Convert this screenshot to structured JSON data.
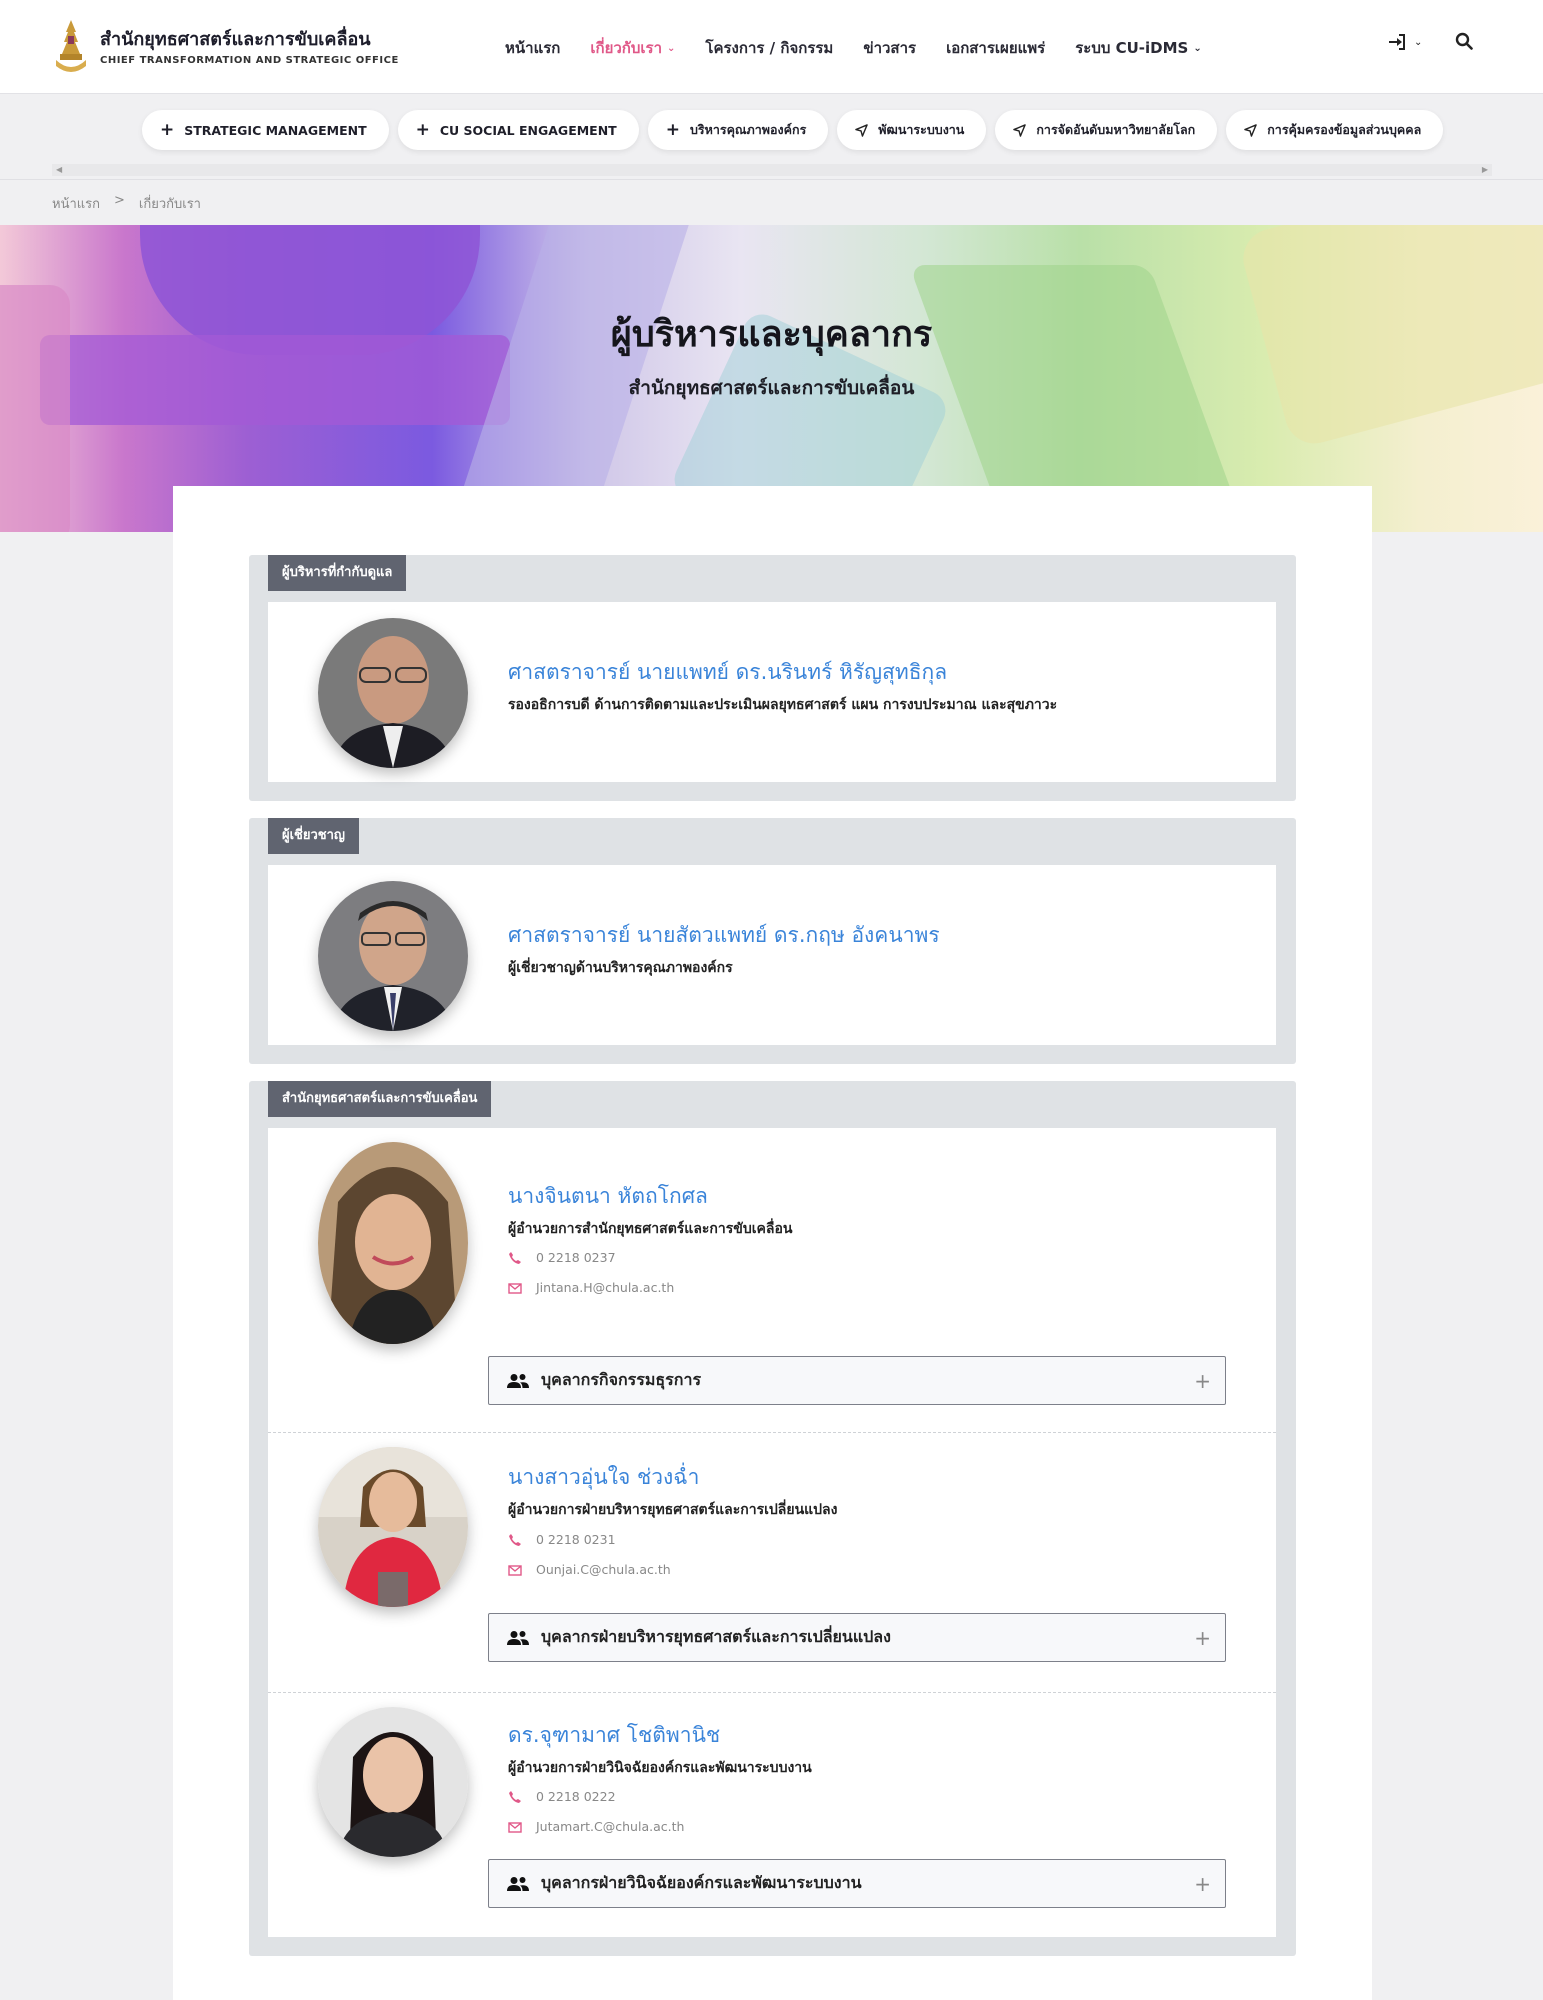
{
  "header": {
    "logo_th": "สำนักยุทธศาสตร์และการขับเคลื่อน",
    "logo_en": "CHIEF TRANSFORMATION AND STRATEGIC OFFICE",
    "nav": [
      "หน้าแรก",
      "เกี่ยวกับเรา",
      "โครงการ / กิจกรรม",
      "ข่าวสาร",
      "เอกสารเผยแพร่",
      "ระบบ CU-iDMS"
    ],
    "active_nav": "เกี่ยวกับเรา",
    "accent": "#e05888"
  },
  "quick_links": [
    {
      "label": "STRATEGIC MANAGEMENT",
      "icon": "plus-icon"
    },
    {
      "label": "CU SOCIAL ENGAGEMENT",
      "icon": "plus-icon"
    },
    {
      "label": "บริหารคุณภาพองค์กร",
      "icon": "plus-icon"
    },
    {
      "label": "พัฒนาระบบงาน",
      "icon": "send-icon"
    },
    {
      "label": "การจัดอันดับมหาวิทยาลัยโลก",
      "icon": "send-icon"
    },
    {
      "label": "การคุ้มครองข้อมูลส่วนบุคคล",
      "icon": "send-icon"
    }
  ],
  "breadcrumb": {
    "home": "หน้าแรก",
    "sep": ">",
    "current": "เกี่ยวกับเรา"
  },
  "banner": {
    "title": "ผู้บริหารและบุคลากร",
    "subtitle": "สำนักยุทธศาสตร์และการขับเคลื่อน"
  },
  "sections": [
    {
      "tag": "ผู้บริหารที่กำกับดูแล",
      "people": [
        {
          "name": "ศาสตราจารย์ นายแพทย์ ดร.นรินทร์ หิรัญสุทธิกุล",
          "role": "รองอธิการบดี ด้านการติดตามและประเมินผลยุทธศาสตร์ แผน การงบประมาณ และสุขภาวะ"
        }
      ]
    },
    {
      "tag": "ผู้เชี่ยวชาญ",
      "people": [
        {
          "name": "ศาสตราจารย์ นายสัตวแพทย์ ดร.กฤษ อังคนาพร",
          "role": "ผู้เชี่ยวชาญด้านบริหารคุณภาพองค์กร"
        }
      ]
    },
    {
      "tag": "สำนักยุทธศาสตร์และการขับเคลื่อน",
      "people": [
        {
          "name": "นางจินตนา หัตถโกศล",
          "role": "ผู้อำนวยการสำนักยุทธศาสตร์และการขับเคลื่อน",
          "phone": "0 2218 0237",
          "email": "Jintana.H@chula.ac.th",
          "group": "บุคลากรกิจกรรมธุรการ"
        },
        {
          "name": "นางสาวอุ่นใจ ช่วงฉ่ำ",
          "role": "ผู้อำนวยการฝ่ายบริหารยุทธศาสตร์และการเปลี่ยนแปลง",
          "phone": "0 2218 0231",
          "email": "Ounjai.C@chula.ac.th",
          "group": "บุคลากรฝ่ายบริหารยุทธศาสตร์และการเปลี่ยนแปลง"
        },
        {
          "name": "ดร.จุฑามาศ โชติพานิช",
          "role": "ผู้อำนวยการฝ่ายวินิจฉัยองค์กรและพัฒนาระบบงาน",
          "phone": "0 2218 0222",
          "email": "Jutamart.C@chula.ac.th",
          "group": "บุคลากรฝ่ายวินิจฉัยองค์กรและพัฒนาระบบงาน"
        }
      ]
    }
  ]
}
